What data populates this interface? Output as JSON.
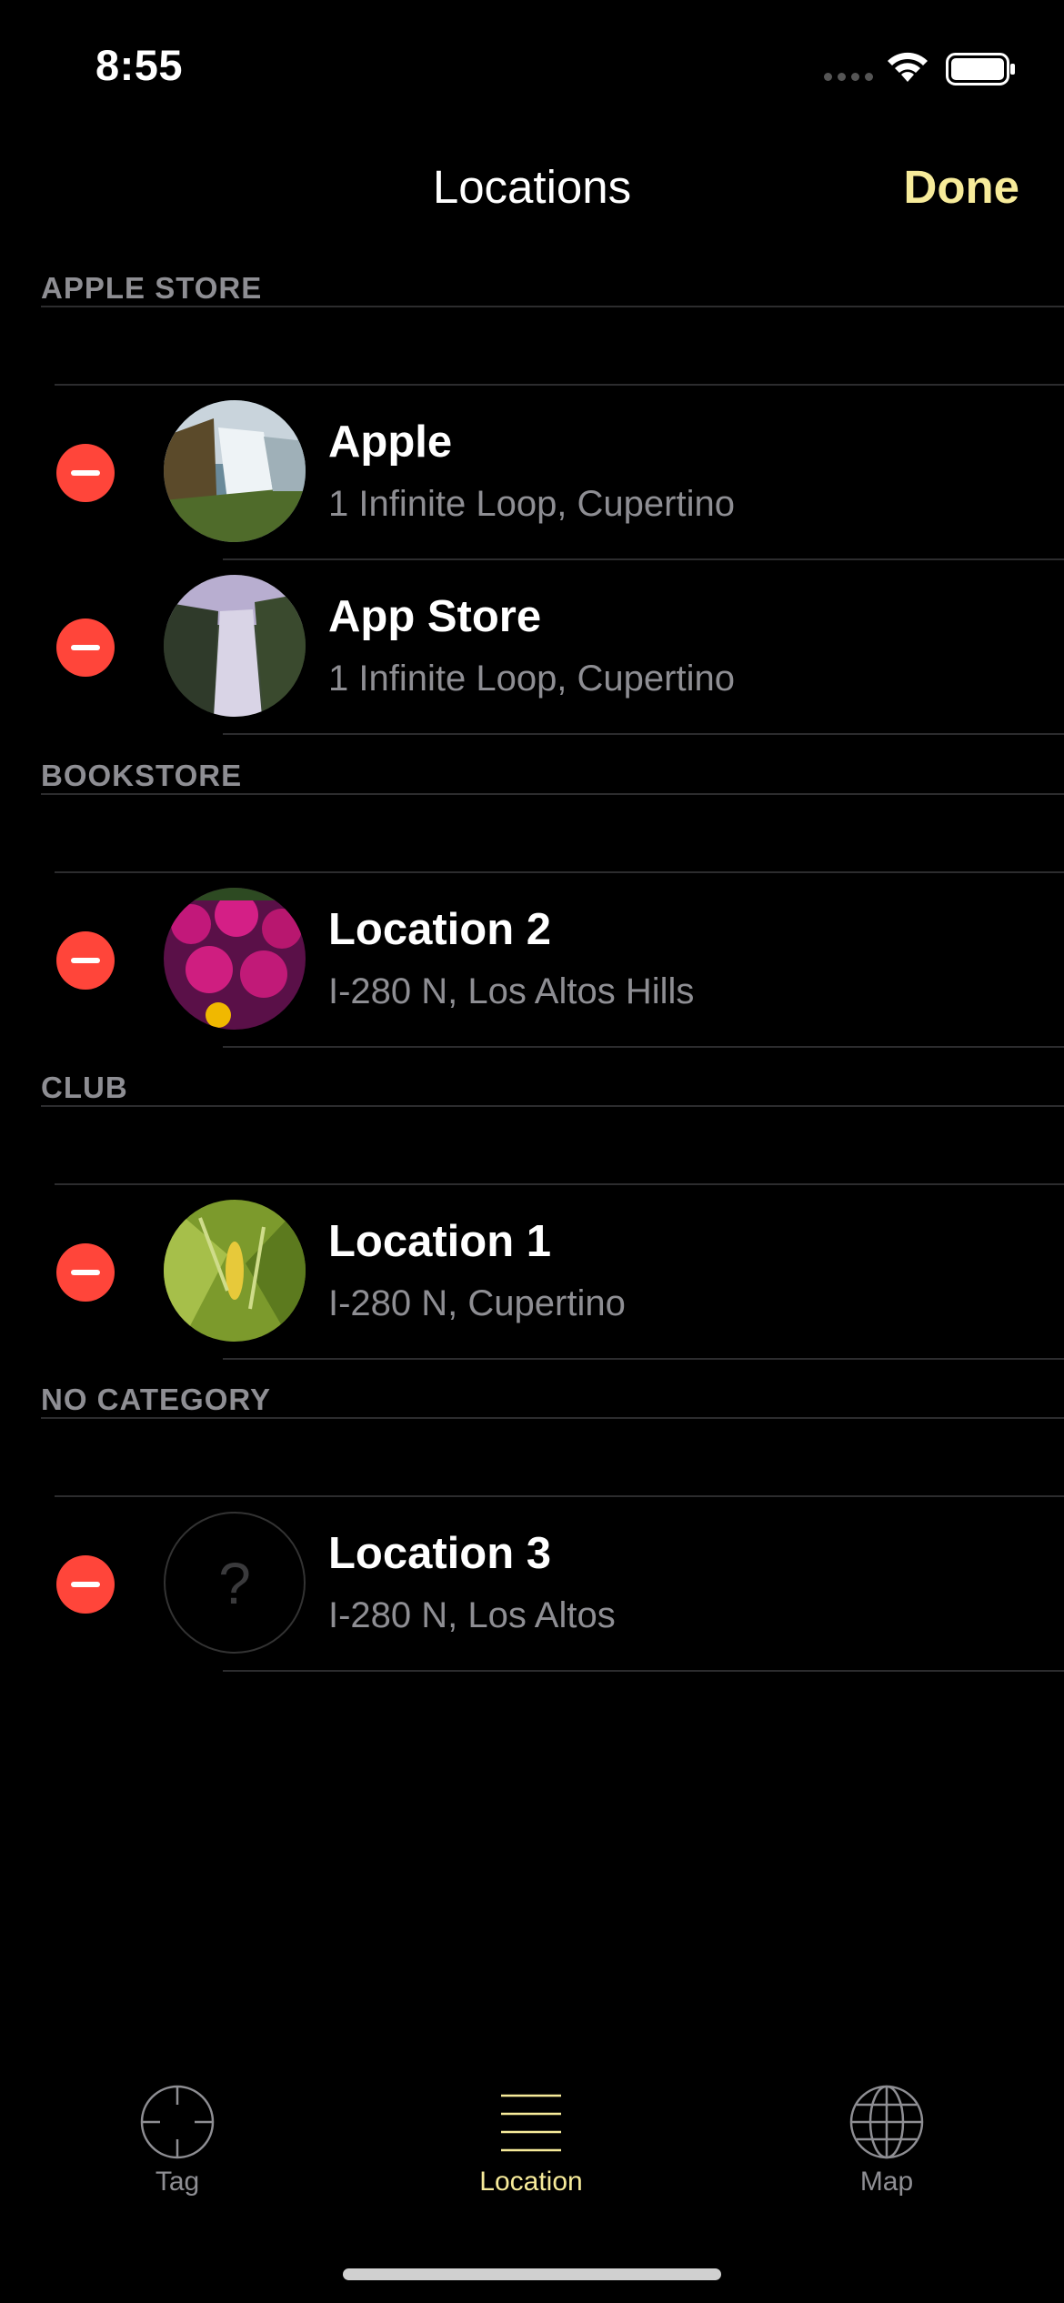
{
  "status_bar": {
    "time": "8:55"
  },
  "nav": {
    "title": "Locations",
    "done_label": "Done"
  },
  "sections": [
    {
      "header": "APPLE STORE",
      "rows": [
        {
          "title": "Apple",
          "subtitle": "1 Infinite Loop, Cupertino",
          "image": "waterfall-photo"
        },
        {
          "title": "App Store",
          "subtitle": "1 Infinite Loop, Cupertino",
          "image": "waterfall-photo"
        }
      ]
    },
    {
      "header": "BOOKSTORE",
      "rows": [
        {
          "title": "Location 2",
          "subtitle": "I-280 N, Los Altos Hills",
          "image": "flowers-photo"
        }
      ]
    },
    {
      "header": "CLUB",
      "rows": [
        {
          "title": "Location 1",
          "subtitle": "I-280 N, Cupertino",
          "image": "leaves-photo"
        }
      ]
    },
    {
      "header": "NO CATEGORY",
      "rows": [
        {
          "title": "Location 3",
          "subtitle": "I-280 N, Los Altos",
          "image": "question-mark-placeholder",
          "placeholder_glyph": "?"
        }
      ]
    }
  ],
  "tabs": [
    {
      "label": "Tag",
      "icon": "crosshair-icon",
      "active": false
    },
    {
      "label": "Location",
      "icon": "list-icon",
      "active": true
    },
    {
      "label": "Map",
      "icon": "globe-icon",
      "active": false
    }
  ],
  "colors": {
    "accent": "#f7eb9a",
    "delete": "#ff453a",
    "secondary_text": "#8e8e93",
    "tab_inactive": "#8e8e93"
  }
}
